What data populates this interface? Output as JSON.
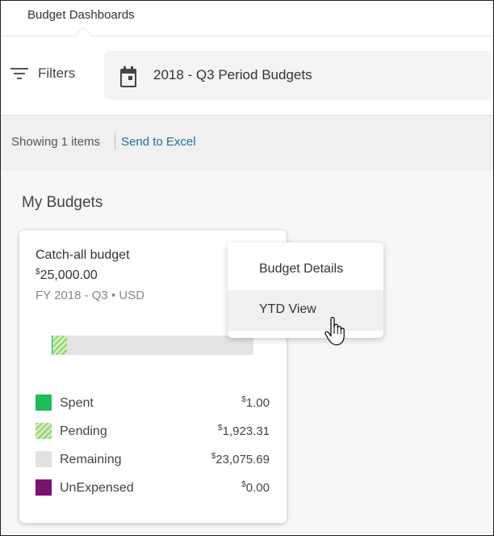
{
  "header": {
    "title": "Budget Dashboards"
  },
  "filterbar": {
    "filters_label": "Filters",
    "period_label": "2018 - Q3 Period Budgets"
  },
  "results": {
    "showing_text": "Showing 1 items",
    "export_link": "Send to Excel"
  },
  "section": {
    "title": "My Budgets"
  },
  "card": {
    "name": "Catch-all budget",
    "amount_currency": "$",
    "amount_value": "25,000.00",
    "meta": "FY 2018 - Q3 • USD",
    "progress": {
      "spent_fraction": 4e-05,
      "pending_fraction": 0.0769
    },
    "legend": [
      {
        "label": "Spent",
        "currency": "$",
        "value": "1.00",
        "color": "#1dbd5c"
      },
      {
        "label": "Pending",
        "currency": "$",
        "value": "1,923.31",
        "color": "#8fd36f"
      },
      {
        "label": "Remaining",
        "currency": "$",
        "value": "23,075.69",
        "color": "#e2e2e2"
      },
      {
        "label": "UnExpensed",
        "currency": "$",
        "value": "0.00",
        "color": "#7a1270"
      }
    ]
  },
  "context_menu": {
    "items": [
      {
        "label": "Budget Details"
      },
      {
        "label": "YTD View"
      }
    ],
    "hovered_index": 1
  },
  "icons": {
    "filters": "filter-icon",
    "period": "calendar-icon",
    "cursor": "hand-pointer-cursor"
  }
}
